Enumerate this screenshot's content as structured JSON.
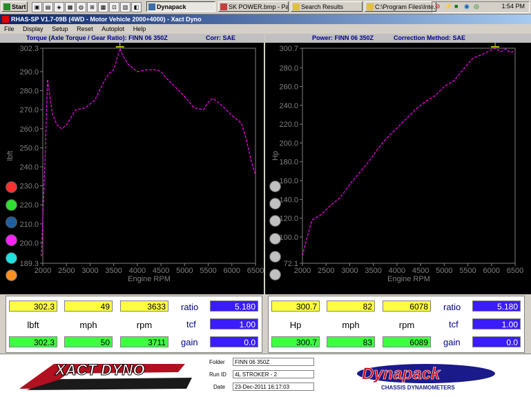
{
  "taskbar": {
    "start_label": "Start",
    "tasks": [
      "Dynapack",
      "SK POWER.bmp - Paint",
      "Search Results",
      "C:\\Program Files\\Inte..."
    ],
    "clock": "1:54 PM"
  },
  "window": {
    "title": "RHAS-SP V1.7-09B  (4WD - Motor Vehicle 2000+4000) - Xact Dyno",
    "menu": [
      "File",
      "Display",
      "Setup",
      "Reset",
      "Autoplot",
      "Help"
    ]
  },
  "torque_header": {
    "title": "Torque (Axle Torque / Gear Ratio): FINN 06 350Z",
    "corr": "Corr: SAE"
  },
  "power_header": {
    "title": "Power: FINN 06 350Z",
    "corr": "Correction Method: SAE"
  },
  "chart_data": [
    {
      "type": "line",
      "ylabel": "lbft",
      "xlabel": "Engine RPM",
      "ylim": [
        189.3,
        302.3
      ],
      "yticks": [
        "302.3",
        "290.0",
        "280.0",
        "270.0",
        "260.0",
        "250.0",
        "240.0",
        "230.0",
        "220.0",
        "210.0",
        "200.0",
        "189.3"
      ],
      "xlim": [
        2000,
        6500
      ],
      "xticks": [
        "2000",
        "2500",
        "3000",
        "3500",
        "4000",
        "4500",
        "5000",
        "5500",
        "6000",
        "6500"
      ],
      "peak_marker": "T",
      "series": [
        {
          "color": "#ff00ff",
          "x": [
            1970,
            2050,
            2100,
            2200,
            2300,
            2400,
            2500,
            2600,
            2700,
            2900,
            3000,
            3100,
            3200,
            3300,
            3400,
            3500,
            3633,
            3700,
            3800,
            3900,
            4000,
            4200,
            4400,
            4500,
            4600,
            4800,
            5000,
            5200,
            5400,
            5500,
            5600,
            5800,
            6000,
            6200,
            6300,
            6400,
            6500
          ],
          "y": [
            193,
            245,
            286,
            268,
            262,
            260,
            262,
            266,
            270,
            271,
            273,
            275,
            280,
            285,
            289,
            291,
            302.3,
            298,
            294,
            292,
            290,
            291,
            291,
            290,
            287,
            282,
            277,
            271,
            270,
            274,
            276,
            272,
            267,
            263,
            255,
            244,
            236
          ]
        }
      ]
    },
    {
      "type": "line",
      "ylabel": "Hp",
      "xlabel": "Engine RPM",
      "ylim": [
        72.1,
        300.7
      ],
      "yticks": [
        "300.7",
        "280.0",
        "260.0",
        "240.0",
        "220.0",
        "200.0",
        "180.0",
        "160.0",
        "140.0",
        "120.0",
        "100.0",
        "72.1"
      ],
      "xlim": [
        2000,
        6500
      ],
      "xticks": [
        "2000",
        "2500",
        "3000",
        "3500",
        "4000",
        "4500",
        "5000",
        "5500",
        "6000",
        "6500"
      ],
      "peak_marker": "T",
      "series": [
        {
          "color": "#ff00ff",
          "x": [
            2000,
            2100,
            2200,
            2400,
            2600,
            2800,
            3000,
            3200,
            3400,
            3600,
            3800,
            4000,
            4200,
            4400,
            4600,
            4800,
            5000,
            5200,
            5400,
            5600,
            5800,
            6000,
            6078,
            6200,
            6300,
            6400,
            6500
          ],
          "y": [
            80,
            100,
            118,
            124,
            134,
            142,
            156,
            168,
            180,
            194,
            206,
            216,
            226,
            236,
            244,
            250,
            260,
            266,
            278,
            290,
            294,
            299,
            300.7,
            297,
            300,
            296,
            298
          ]
        }
      ]
    }
  ],
  "swatches_left": [
    "#ff3030",
    "#30e030",
    "#2060a0",
    "#ff20ff",
    "#20e0e0",
    "#ff9020"
  ],
  "readouts_left": {
    "top": [
      "302.3",
      "49",
      "3633"
    ],
    "labels": [
      "lbft",
      "mph",
      "rpm"
    ],
    "bottom": [
      "302.3",
      "50",
      "3711"
    ],
    "ratio_label": "ratio",
    "ratio": "5.180",
    "tcf_label": "tcf",
    "tcf": "1.00",
    "gain_label": "gain",
    "gain": "0.0"
  },
  "readouts_right": {
    "top": [
      "300.7",
      "82",
      "6078"
    ],
    "labels": [
      "Hp",
      "mph",
      "rpm"
    ],
    "bottom": [
      "300.7",
      "83",
      "6089"
    ],
    "ratio_label": "ratio",
    "ratio": "5.180",
    "tcf_label": "tcf",
    "tcf": "1.00",
    "gain_label": "gain",
    "gain": "0.0"
  },
  "footer": {
    "folder_label": "Folder",
    "folder": "FINN 06 350Z",
    "runid_label": "Run ID",
    "runid": "4L STROKER - 2",
    "date_label": "Date",
    "date": "23-Dec-2011 16:17:03",
    "logo_left": "XACT DYNO",
    "logo_right": "Dynapack",
    "logo_right_sub": "CHASSIS DYNAMOMETERS"
  }
}
